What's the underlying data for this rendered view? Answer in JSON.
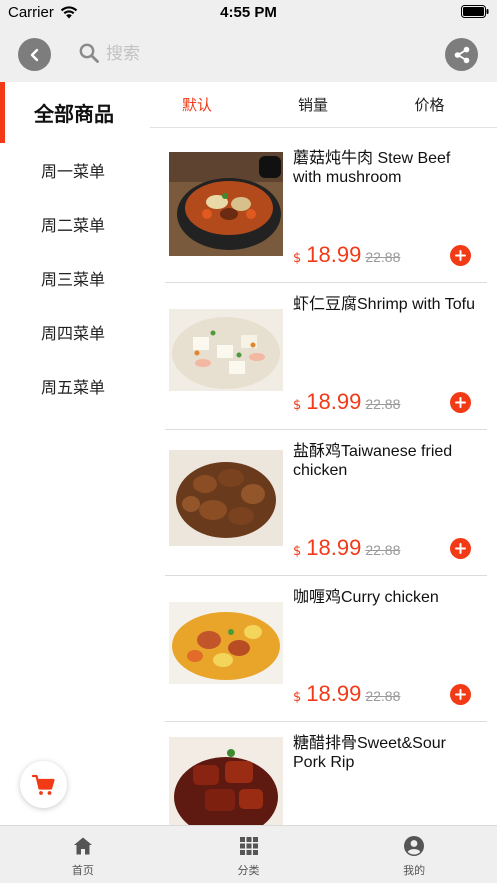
{
  "status_bar": {
    "carrier": "Carrier",
    "time": "4:55 PM"
  },
  "header": {
    "search_placeholder": "搜索",
    "back_icon": "chevron-left-icon",
    "share_icon": "share-icon",
    "bar_color": "#efefef",
    "button_color": "#7d7d7d"
  },
  "sidebar": {
    "all_label": "全部商品",
    "items": [
      {
        "label": "周一菜单"
      },
      {
        "label": "周二菜单"
      },
      {
        "label": "周三菜单"
      },
      {
        "label": "周四菜单"
      },
      {
        "label": "周五菜单"
      }
    ]
  },
  "sort_tabs": [
    {
      "label": "默认",
      "active": true
    },
    {
      "label": "销量",
      "active": false
    },
    {
      "label": "价格",
      "active": false
    }
  ],
  "products": [
    {
      "name": "蘑菇炖牛肉 Stew Beef with mushroom",
      "currency": "$",
      "price": "18.99",
      "original_price": "22.88"
    },
    {
      "name": "虾仁豆腐Shrimp with Tofu",
      "currency": "$",
      "price": "18.99",
      "original_price": "22.88"
    },
    {
      "name": "盐酥鸡Taiwanese fried chicken",
      "currency": "$",
      "price": "18.99",
      "original_price": "22.88"
    },
    {
      "name": "咖喱鸡Curry chicken",
      "currency": "$",
      "price": "18.99",
      "original_price": "22.88"
    },
    {
      "name": "糖醋排骨Sweet&Sour Pork Rip",
      "currency": "$",
      "price": "",
      "original_price": ""
    }
  ],
  "cart": {
    "icon": "shopping-cart-icon"
  },
  "bottom_nav": [
    {
      "label": "首页",
      "icon": "home-icon"
    },
    {
      "label": "分类",
      "icon": "grid-icon"
    },
    {
      "label": "我的",
      "icon": "user-icon"
    }
  ],
  "colors": {
    "accent": "#f23a17",
    "strike_price": "#9a9a9a",
    "divider": "#dcdcdc"
  }
}
